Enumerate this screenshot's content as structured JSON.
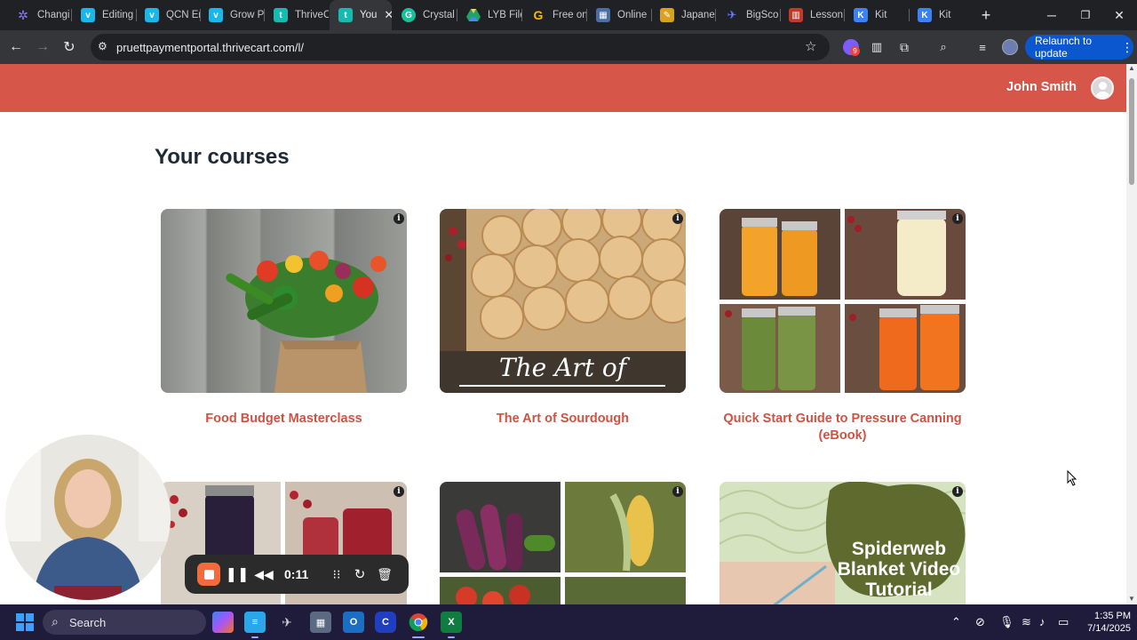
{
  "browser": {
    "tabs": [
      {
        "label": "Changi",
        "icon": "sparkle-icon",
        "color": "#7b6cff"
      },
      {
        "label": "Editing",
        "icon": "vimeo-icon",
        "color": "#1ab7ea"
      },
      {
        "label": "QCN Er",
        "icon": "vimeo-icon",
        "color": "#1ab7ea"
      },
      {
        "label": "Grow P",
        "icon": "vimeo-icon",
        "color": "#1ab7ea"
      },
      {
        "label": "ThriveC",
        "icon": "thrivecart-icon",
        "color": "#18b9b0"
      },
      {
        "label": "You",
        "icon": "thrivecart-icon",
        "color": "#18b9b0",
        "active": true
      },
      {
        "label": "Crystal",
        "icon": "grammarly-icon",
        "color": "#15c39a"
      },
      {
        "label": "LYB File",
        "icon": "drive-icon",
        "color": "#f4b400"
      },
      {
        "label": "Free on",
        "icon": "g-icon",
        "color": "#fbbc05"
      },
      {
        "label": "Online",
        "icon": "calculator-icon",
        "color": "#4a6fa5"
      },
      {
        "label": "Japane",
        "icon": "map-icon",
        "color": "#d8a21f"
      },
      {
        "label": "BigSco",
        "icon": "bigscoots-icon",
        "color": "#3f51b5"
      },
      {
        "label": "Lesson",
        "icon": "book-icon",
        "color": "#c0392b"
      },
      {
        "label": "Kit",
        "icon": "kit-icon",
        "color": "#3b82f6"
      },
      {
        "label": "Kit",
        "icon": "kit-icon",
        "color": "#3b82f6"
      }
    ],
    "url": "pruettpaymentportal.thrivecart.com/l/",
    "relaunch_label": "Relaunch to update",
    "extension_badge": "9"
  },
  "site": {
    "header_color": "#d6574a",
    "user_name": "John Smith",
    "page_title": "Your courses",
    "courses": [
      {
        "title": "Food Budget Masterclass",
        "image": "vegetables-paper-bag-photo"
      },
      {
        "title": "The Art of Sourdough",
        "image": "sourdough-rolls-photo",
        "overlay_text": "The Art of"
      },
      {
        "title": "Quick Start Guide to Pressure Canning (eBook)",
        "image": "canning-jars-collage"
      },
      {
        "title": "",
        "image": "jam-jars-collage"
      },
      {
        "title": "",
        "image": "garden-vegetables-collage"
      },
      {
        "title": "",
        "image": "crochet-blanket-photo",
        "overlay_text": "Spiderweb Blanket Video Tutorial"
      }
    ]
  },
  "recorder": {
    "time": "0:11"
  },
  "taskbar": {
    "search_label": "Search",
    "time": "1:35 PM",
    "date": "7/14/2025"
  }
}
